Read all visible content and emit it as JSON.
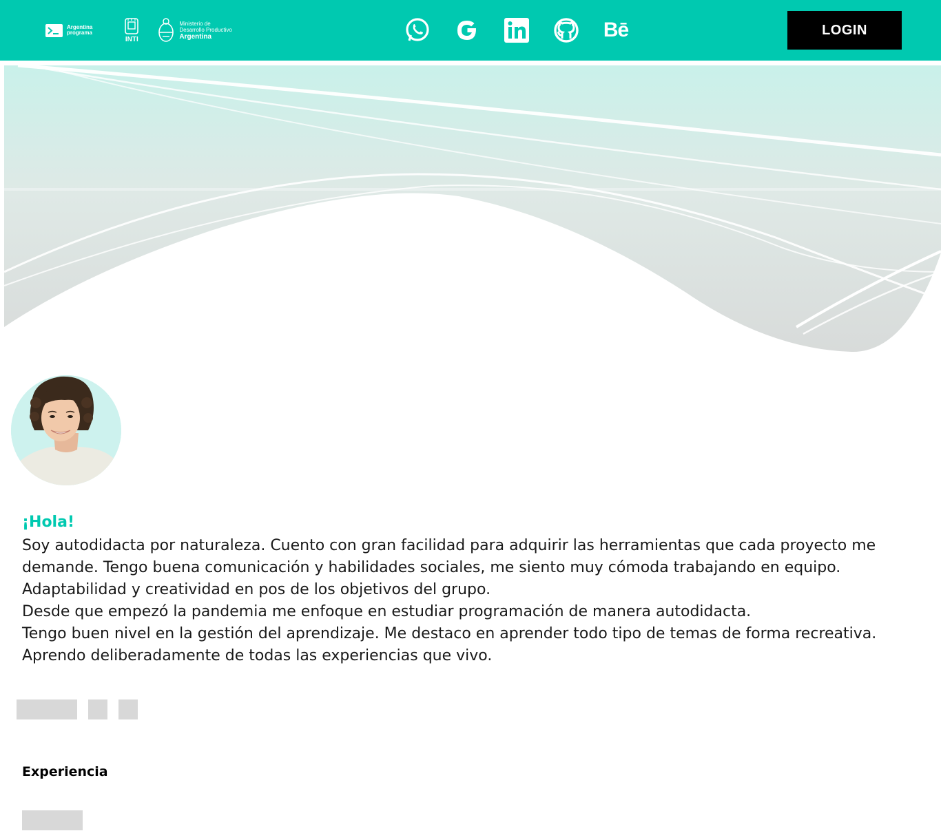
{
  "header": {
    "brand_argentina_programa": [
      "Argentina",
      "programa"
    ],
    "brand_inti": "INTI",
    "brand_ministerio": [
      "Ministerio de",
      "Desarrollo Productivo",
      "Argentina"
    ],
    "social_icons": [
      "whatsapp-icon",
      "google-icon",
      "linkedin-icon",
      "github-icon",
      "behance-icon"
    ],
    "behance_text": "Bē",
    "login_label": "LOGIN"
  },
  "colors": {
    "accent": "#00c9b0",
    "login_bg": "#000000",
    "placeholder": "#d8d8d8"
  },
  "about": {
    "greeting": "¡Hola!",
    "paragraphs": [
      "Soy autodidacta por naturaleza. Cuento con gran facilidad para adquirir las herramientas que cada proyecto me demande. Tengo buena comunicación y habilidades sociales, me siento muy cómoda trabajando en equipo. Adaptabilidad y creatividad en pos de los objetivos del grupo.",
      "Desde que empezó la pandemia me enfoque en estudiar programación de manera autodidacta.",
      "Tengo buen nivel en la gestión del aprendizaje. Me destaco en aprender todo tipo de temas de forma recreativa. Aprendo deliberadamente de todas las experiencias que vivo."
    ]
  },
  "experience": {
    "title": "Experiencia"
  }
}
